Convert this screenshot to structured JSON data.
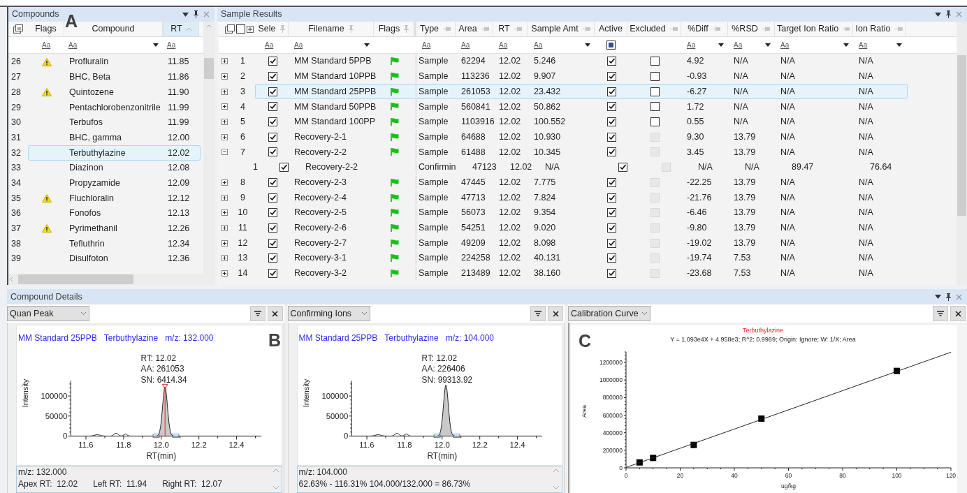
{
  "panel_labels": [
    "A",
    "B",
    "C"
  ],
  "compounds": {
    "title": "Compounds",
    "columns": [
      {
        "label": "Flags",
        "sorted": false,
        "filter": {
          "label": "Aa",
          "dropdown": false
        }
      },
      {
        "label": "Compound",
        "sorted": false,
        "filter": {
          "label": "Aa",
          "dropdown": true
        }
      },
      {
        "label": "RT",
        "sorted": true,
        "filter": {
          "label": "Aa",
          "dropdown": false
        }
      }
    ],
    "rows": [
      {
        "index": "26",
        "warning": true,
        "name": "Profluralin",
        "rt": "11.85",
        "selected": false
      },
      {
        "index": "27",
        "warning": false,
        "name": "BHC, Beta",
        "rt": "11.86",
        "selected": false
      },
      {
        "index": "28",
        "warning": true,
        "name": "Quintozene",
        "rt": "11.90",
        "selected": false
      },
      {
        "index": "29",
        "warning": false,
        "name": "Pentachlorobenzonitrile",
        "rt": "11.99",
        "selected": false
      },
      {
        "index": "30",
        "warning": false,
        "name": "Terbufos",
        "rt": "11.99",
        "selected": false
      },
      {
        "index": "31",
        "warning": false,
        "name": "BHC, gamma",
        "rt": "12.00",
        "selected": false
      },
      {
        "index": "32",
        "warning": false,
        "name": "Terbuthylazine",
        "rt": "12.02",
        "selected": true
      },
      {
        "index": "33",
        "warning": false,
        "name": "Diazinon",
        "rt": "12.08",
        "selected": false
      },
      {
        "index": "34",
        "warning": false,
        "name": "Propyzamide",
        "rt": "12.09",
        "selected": false
      },
      {
        "index": "35",
        "warning": true,
        "name": "Fluchloralin",
        "rt": "12.12",
        "selected": false
      },
      {
        "index": "36",
        "warning": false,
        "name": "Fonofos",
        "rt": "12.13",
        "selected": false
      },
      {
        "index": "37",
        "warning": true,
        "name": "Pyrimethanil",
        "rt": "12.26",
        "selected": false
      },
      {
        "index": "38",
        "warning": false,
        "name": "Tefluthrin",
        "rt": "12.34",
        "selected": false
      },
      {
        "index": "39",
        "warning": false,
        "name": "Disulfoton",
        "rt": "12.36",
        "selected": false
      }
    ]
  },
  "sample_results": {
    "title": "Sample Results",
    "header_checkbox_checked": false,
    "columns": [
      {
        "label": "Sele",
        "pinned": true,
        "filter": {
          "kind": "text",
          "label": "Aa",
          "dropdown": false
        }
      },
      {
        "label": "Filename",
        "pinned": true,
        "filter": {
          "kind": "text",
          "label": "Aa",
          "dropdown": true
        }
      },
      {
        "label": "Flags",
        "pinned": true,
        "filter": {
          "kind": "none"
        }
      },
      {
        "label": "Type",
        "pinned": false,
        "filter": {
          "kind": "text",
          "label": "Aa",
          "dropdown": false
        }
      },
      {
        "label": "Area",
        "pinned": false,
        "filter": {
          "kind": "text",
          "label": "Aa",
          "dropdown": false
        }
      },
      {
        "label": "RT",
        "pinned": false,
        "filter": {
          "kind": "text",
          "label": "Aa",
          "dropdown": false
        }
      },
      {
        "label": "Sample Amt",
        "pinned": false,
        "filter": {
          "kind": "text",
          "label": "Aa",
          "dropdown": true
        }
      },
      {
        "label": "Active",
        "filter": {
          "kind": "checkbox",
          "indeterminate": true
        }
      },
      {
        "label": "Excluded",
        "pinned": false,
        "filter": {
          "kind": "none"
        }
      },
      {
        "label": "%Diff",
        "pinned": false,
        "filter": {
          "kind": "text",
          "label": "Aa",
          "dropdown": true
        }
      },
      {
        "label": "%RSD",
        "pinned": false,
        "filter": {
          "kind": "text",
          "label": "Aa",
          "dropdown": true
        }
      },
      {
        "label": "Target Ion Ratio",
        "pinned": false,
        "filter": {
          "kind": "text",
          "label": "Aa",
          "dropdown": true
        }
      },
      {
        "label": "Ion Ratio",
        "pinned": false,
        "filter": {
          "kind": "text",
          "label": "Aa",
          "dropdown": true
        }
      }
    ],
    "rows": [
      {
        "kind": "sample",
        "expanded": false,
        "index": "1",
        "checked": true,
        "filename": "MM Standard 5PPB",
        "flag": true,
        "type": "Sample",
        "area": "62294",
        "rt": "12.02",
        "amount": "5.246",
        "active": true,
        "excluded": false,
        "excluded_disabled": false,
        "diff": "4.92",
        "rsd": "N/A",
        "target_ion_ratio": "N/A",
        "ion_ratio": "N/A",
        "selected": false
      },
      {
        "kind": "sample",
        "expanded": false,
        "index": "2",
        "checked": true,
        "filename": "MM Standard 10PPB",
        "flag": true,
        "type": "Sample",
        "area": "113236",
        "rt": "12.02",
        "amount": "9.907",
        "active": true,
        "excluded": false,
        "excluded_disabled": false,
        "diff": "-0.93",
        "rsd": "N/A",
        "target_ion_ratio": "N/A",
        "ion_ratio": "N/A",
        "selected": false
      },
      {
        "kind": "sample",
        "expanded": false,
        "index": "3",
        "checked": true,
        "filename": "MM Standard 25PPB",
        "flag": true,
        "type": "Sample",
        "area": "261053",
        "rt": "12.02",
        "amount": "23.432",
        "active": true,
        "excluded": false,
        "excluded_disabled": false,
        "diff": "-6.27",
        "rsd": "N/A",
        "target_ion_ratio": "N/A",
        "ion_ratio": "N/A",
        "selected": true
      },
      {
        "kind": "sample",
        "expanded": false,
        "index": "4",
        "checked": true,
        "filename": "MM Standard 50PPB",
        "flag": true,
        "type": "Sample",
        "area": "560841",
        "rt": "12.02",
        "amount": "50.862",
        "active": true,
        "excluded": false,
        "excluded_disabled": false,
        "diff": "1.72",
        "rsd": "N/A",
        "target_ion_ratio": "N/A",
        "ion_ratio": "N/A",
        "selected": false
      },
      {
        "kind": "sample",
        "expanded": false,
        "index": "5",
        "checked": true,
        "filename": "MM Standard 100PP",
        "flag": true,
        "type": "Sample",
        "area": "1103916",
        "rt": "12.02",
        "amount": "100.552",
        "active": true,
        "excluded": false,
        "excluded_disabled": false,
        "diff": "0.55",
        "rsd": "N/A",
        "target_ion_ratio": "N/A",
        "ion_ratio": "N/A",
        "selected": false
      },
      {
        "kind": "sample",
        "expanded": false,
        "index": "6",
        "checked": true,
        "filename": "Recovery-2-1",
        "flag": true,
        "type": "Sample",
        "area": "64688",
        "rt": "12.02",
        "amount": "10.930",
        "active": true,
        "excluded": false,
        "excluded_disabled": true,
        "diff": "9.30",
        "rsd": "13.79",
        "target_ion_ratio": "N/A",
        "ion_ratio": "N/A",
        "selected": false
      },
      {
        "kind": "sample",
        "expanded": true,
        "index": "7",
        "checked": true,
        "filename": "Recovery-2-2",
        "flag": true,
        "type": "Sample",
        "area": "61488",
        "rt": "12.02",
        "amount": "10.345",
        "active": true,
        "excluded": false,
        "excluded_disabled": true,
        "diff": "3.45",
        "rsd": "13.79",
        "target_ion_ratio": "N/A",
        "ion_ratio": "N/A",
        "selected": false
      },
      {
        "kind": "ion",
        "index": "1",
        "checked": true,
        "filename": "Recovery-2-2",
        "flag": false,
        "type": "Confirmin",
        "area": "47123",
        "rt": "12.02",
        "amount": "N/A",
        "active": true,
        "excluded": false,
        "excluded_disabled": true,
        "diff": "N/A",
        "rsd": "N/A",
        "target_ion_ratio": "89.47",
        "ion_ratio": "76.64",
        "selected": false
      },
      {
        "kind": "sample",
        "expanded": false,
        "index": "8",
        "checked": true,
        "filename": "Recovery-2-3",
        "flag": true,
        "type": "Sample",
        "area": "47445",
        "rt": "12.02",
        "amount": "7.775",
        "active": true,
        "excluded": false,
        "excluded_disabled": true,
        "diff": "-22.25",
        "rsd": "13.79",
        "target_ion_ratio": "N/A",
        "ion_ratio": "N/A",
        "selected": false
      },
      {
        "kind": "sample",
        "expanded": false,
        "index": "9",
        "checked": true,
        "filename": "Recovery-2-4",
        "flag": true,
        "type": "Sample",
        "area": "47713",
        "rt": "12.02",
        "amount": "7.824",
        "active": true,
        "excluded": false,
        "excluded_disabled": true,
        "diff": "-21.76",
        "rsd": "13.79",
        "target_ion_ratio": "N/A",
        "ion_ratio": "N/A",
        "selected": false
      },
      {
        "kind": "sample",
        "expanded": false,
        "index": "10",
        "checked": true,
        "filename": "Recovery-2-5",
        "flag": true,
        "type": "Sample",
        "area": "56073",
        "rt": "12.02",
        "amount": "9.354",
        "active": true,
        "excluded": false,
        "excluded_disabled": true,
        "diff": "-6.46",
        "rsd": "13.79",
        "target_ion_ratio": "N/A",
        "ion_ratio": "N/A",
        "selected": false
      },
      {
        "kind": "sample",
        "expanded": false,
        "index": "11",
        "checked": true,
        "filename": "Recovery-2-6",
        "flag": true,
        "type": "Sample",
        "area": "54251",
        "rt": "12.02",
        "amount": "9.020",
        "active": true,
        "excluded": false,
        "excluded_disabled": true,
        "diff": "-9.80",
        "rsd": "13.79",
        "target_ion_ratio": "N/A",
        "ion_ratio": "N/A",
        "selected": false
      },
      {
        "kind": "sample",
        "expanded": false,
        "index": "12",
        "checked": true,
        "filename": "Recovery-2-7",
        "flag": true,
        "type": "Sample",
        "area": "49209",
        "rt": "12.02",
        "amount": "8.098",
        "active": true,
        "excluded": false,
        "excluded_disabled": true,
        "diff": "-19.02",
        "rsd": "13.79",
        "target_ion_ratio": "N/A",
        "ion_ratio": "N/A",
        "selected": false
      },
      {
        "kind": "sample",
        "expanded": false,
        "index": "13",
        "checked": true,
        "filename": "Recovery-3-1",
        "flag": true,
        "type": "Sample",
        "area": "224258",
        "rt": "12.02",
        "amount": "40.131",
        "active": true,
        "excluded": false,
        "excluded_disabled": true,
        "diff": "-19.74",
        "rsd": "7.53",
        "target_ion_ratio": "N/A",
        "ion_ratio": "N/A",
        "selected": false
      },
      {
        "kind": "sample",
        "expanded": false,
        "index": "14",
        "checked": true,
        "filename": "Recovery-3-2",
        "flag": true,
        "type": "Sample",
        "area": "213489",
        "rt": "12.02",
        "amount": "38.160",
        "active": true,
        "excluded": false,
        "excluded_disabled": true,
        "diff": "-23.68",
        "rsd": "7.53",
        "target_ion_ratio": "N/A",
        "ion_ratio": "N/A",
        "selected": false
      }
    ]
  },
  "compound_details": {
    "title": "Compound Details",
    "panels": [
      {
        "kind": "peak",
        "dropdown": "Quan Peak",
        "header": [
          "MM Standard 25PPB",
          "Terbuthylazine",
          "m/z: 132.000"
        ],
        "peak_labels": [
          "RT: 12.02",
          "AA: 261053",
          "SN: 6414.34"
        ],
        "apex_marker": true,
        "ylabel": "Intensity",
        "xlabel": "RT(min)",
        "yticks": [
          "100000",
          "50000",
          "0"
        ],
        "xticks": [
          "11.6",
          "11.8",
          "12.0",
          "12.2",
          "12.4"
        ],
        "info": [
          [
            "m/z: 132.000"
          ],
          [
            "Apex RT:  12.02",
            "Left RT:  11.94",
            "Right RT:  12.07"
          ]
        ]
      },
      {
        "kind": "peak",
        "dropdown": "Confirming Ions",
        "header": [
          "MM Standard 25PPB",
          "Terbuthylazine",
          "m/z: 104.000"
        ],
        "peak_labels": [
          "RT: 12.02",
          "AA: 226406",
          "SN: 99313.92"
        ],
        "apex_marker": false,
        "ylabel": "Intensity",
        "xlabel": "RT(min)",
        "yticks": [
          "100000",
          "50000",
          "0"
        ],
        "xticks": [
          "11.6",
          "11.8",
          "12.0",
          "12.2",
          "12.4"
        ],
        "info": [
          [
            "m/z: 104.000"
          ],
          [
            "62.63% - 116.31% 104.000/132.000 = 86.73%"
          ]
        ]
      },
      {
        "kind": "calibration",
        "dropdown": "Calibration Curve",
        "equation": "Y = 1.093e4X + 4.958e3; R^2: 0.9989; Origin: Ignore; W: 1/X; Area",
        "chart_data": {
          "type": "scatter",
          "title": "Terbuthylazine",
          "xlabel": "ug/kg",
          "ylabel": "Area",
          "x": [
            0,
            5,
            10,
            25,
            50,
            100,
            120
          ],
          "series": [
            {
              "type": "scatter",
              "color": "#000000",
              "values": [
                null,
                62000,
                113000,
                261000,
                561000,
                1104000,
                null
              ]
            },
            {
              "type": "line",
              "color": "#222222",
              "values": [
                5000,
                60000,
                114000,
                278000,
                551000,
                1098000,
                1317000
              ]
            }
          ],
          "xlim": [
            0,
            120
          ],
          "ylim": [
            0,
            1320000
          ],
          "xticks": [
            0,
            20,
            40,
            60,
            80,
            100,
            120
          ],
          "yticks": [
            0,
            200000,
            400000,
            600000,
            800000,
            1000000,
            1200000
          ]
        }
      }
    ]
  }
}
